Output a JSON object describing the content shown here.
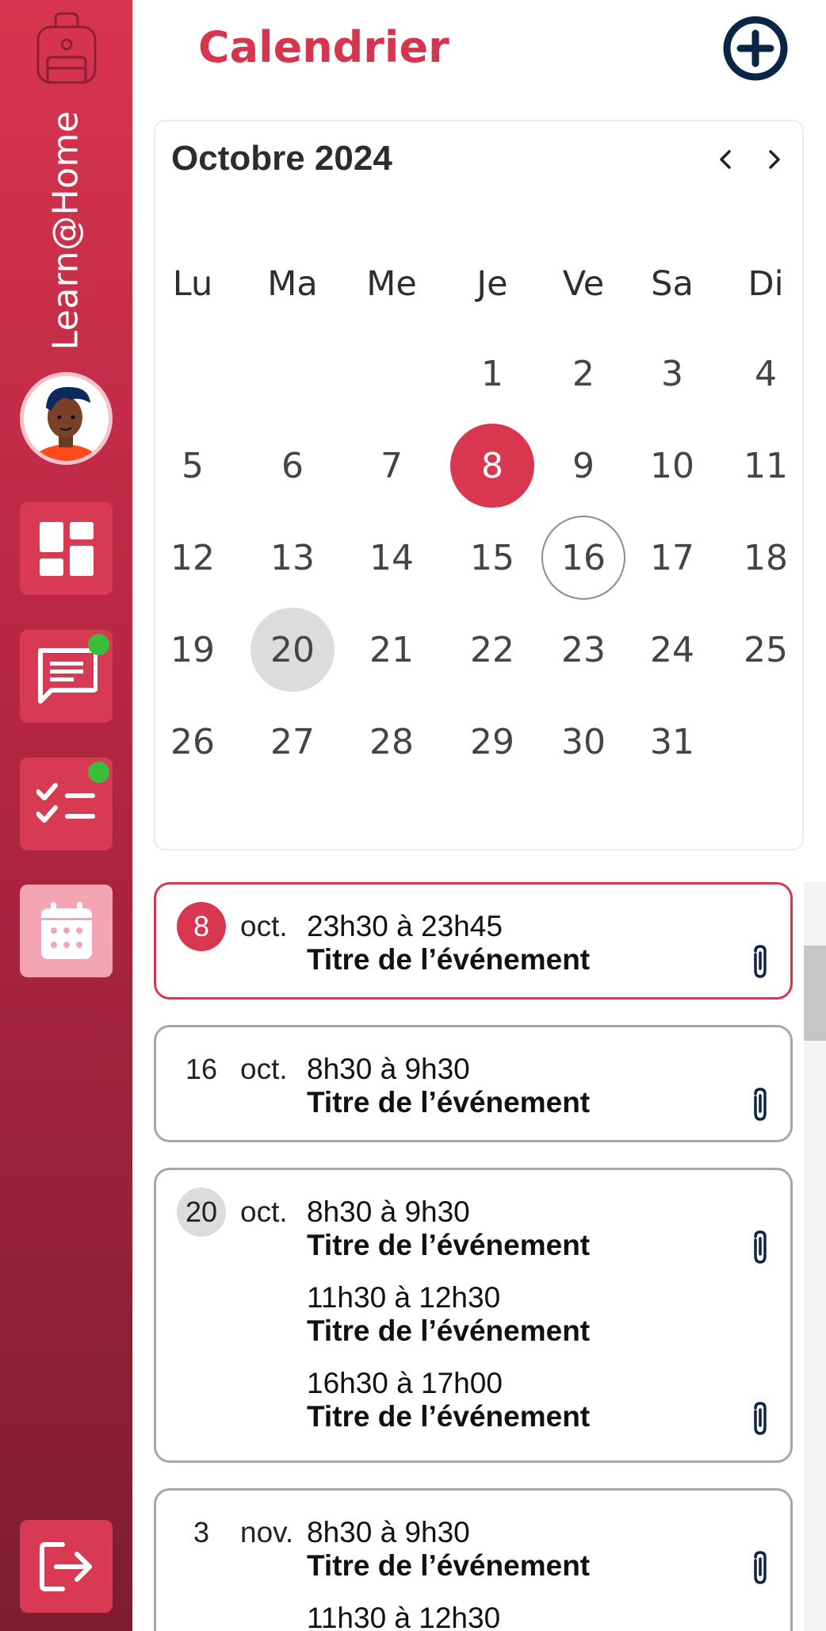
{
  "sidebar": {
    "brand": "Learn@Home",
    "nav": [
      {
        "icon": "dashboard-icon",
        "has_badge": false,
        "active": false
      },
      {
        "icon": "messages-icon",
        "has_badge": true,
        "active": false
      },
      {
        "icon": "tasks-icon",
        "has_badge": true,
        "active": false
      },
      {
        "icon": "calendar-icon",
        "has_badge": false,
        "active": true
      }
    ],
    "badge_color": "#3cbd3a"
  },
  "header": {
    "title": "Calendrier",
    "add_icon": "plus-circle-icon"
  },
  "calendar": {
    "month_label": "Octobre 2024",
    "weekdays": [
      "Lu",
      "Ma",
      "Me",
      "Je",
      "Ve",
      "Sa",
      "Di"
    ],
    "weeks": [
      [
        "",
        "",
        "",
        "1",
        "2",
        "3",
        "4"
      ],
      [
        "5",
        "6",
        "7",
        "8",
        "9",
        "10",
        "11"
      ],
      [
        "12",
        "13",
        "14",
        "15",
        "16",
        "17",
        "18"
      ],
      [
        "19",
        "20",
        "21",
        "22",
        "23",
        "24",
        "25"
      ],
      [
        "26",
        "27",
        "28",
        "29",
        "30",
        "31",
        ""
      ]
    ],
    "today": "8",
    "outlined": "16",
    "highlighted": "20"
  },
  "events": [
    {
      "day": "8",
      "month": "oct.",
      "style": "today",
      "items": [
        {
          "time": "23h30 à 23h45",
          "title": "Titre de l’événement",
          "attachment": true
        }
      ]
    },
    {
      "day": "16",
      "month": "oct.",
      "style": "plain",
      "items": [
        {
          "time": "8h30 à 9h30",
          "title": "Titre de l’événement",
          "attachment": true
        }
      ]
    },
    {
      "day": "20",
      "month": "oct.",
      "style": "grey",
      "items": [
        {
          "time": "8h30 à 9h30",
          "title": "Titre de l’événement",
          "attachment": true
        },
        {
          "time": "11h30 à 12h30",
          "title": "Titre de l’événement",
          "attachment": false
        },
        {
          "time": "16h30 à 17h00",
          "title": "Titre de l’événement",
          "attachment": true
        }
      ]
    },
    {
      "day": "3",
      "month": "nov.",
      "style": "plain",
      "items": [
        {
          "time": "8h30 à 9h30",
          "title": "Titre de l’événement",
          "attachment": true
        },
        {
          "time": "11h30 à 12h30",
          "title": "",
          "attachment": false
        }
      ]
    }
  ],
  "colors": {
    "accent": "#d93650",
    "navy": "#0b2545",
    "sidebar_top": "#d8344f",
    "sidebar_bottom": "#7e1d30"
  }
}
